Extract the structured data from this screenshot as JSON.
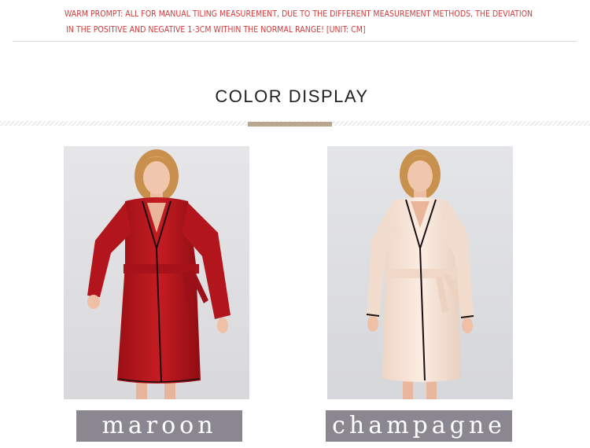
{
  "notice": {
    "line1": "WARM PROMPT: ALL FOR MANUAL TILING MEASUREMENT, DUE TO THE DIFFERENT MEASUREMENT METHODS, THE DEVIATION",
    "line2": "IN THE POSITIVE AND NEGATIVE 1-3CM WITHIN THE NORMAL RANGE! [UNIT: CM]",
    "color": "#d43a3a"
  },
  "section": {
    "title": "COLOR DISPLAY",
    "accent_color": "#b8a78e"
  },
  "colors": [
    {
      "label": "maroon",
      "robe_color": "#b3151c"
    },
    {
      "label": "champagne",
      "robe_color": "#f6e3d6"
    }
  ],
  "label_bg": "#8a8790"
}
